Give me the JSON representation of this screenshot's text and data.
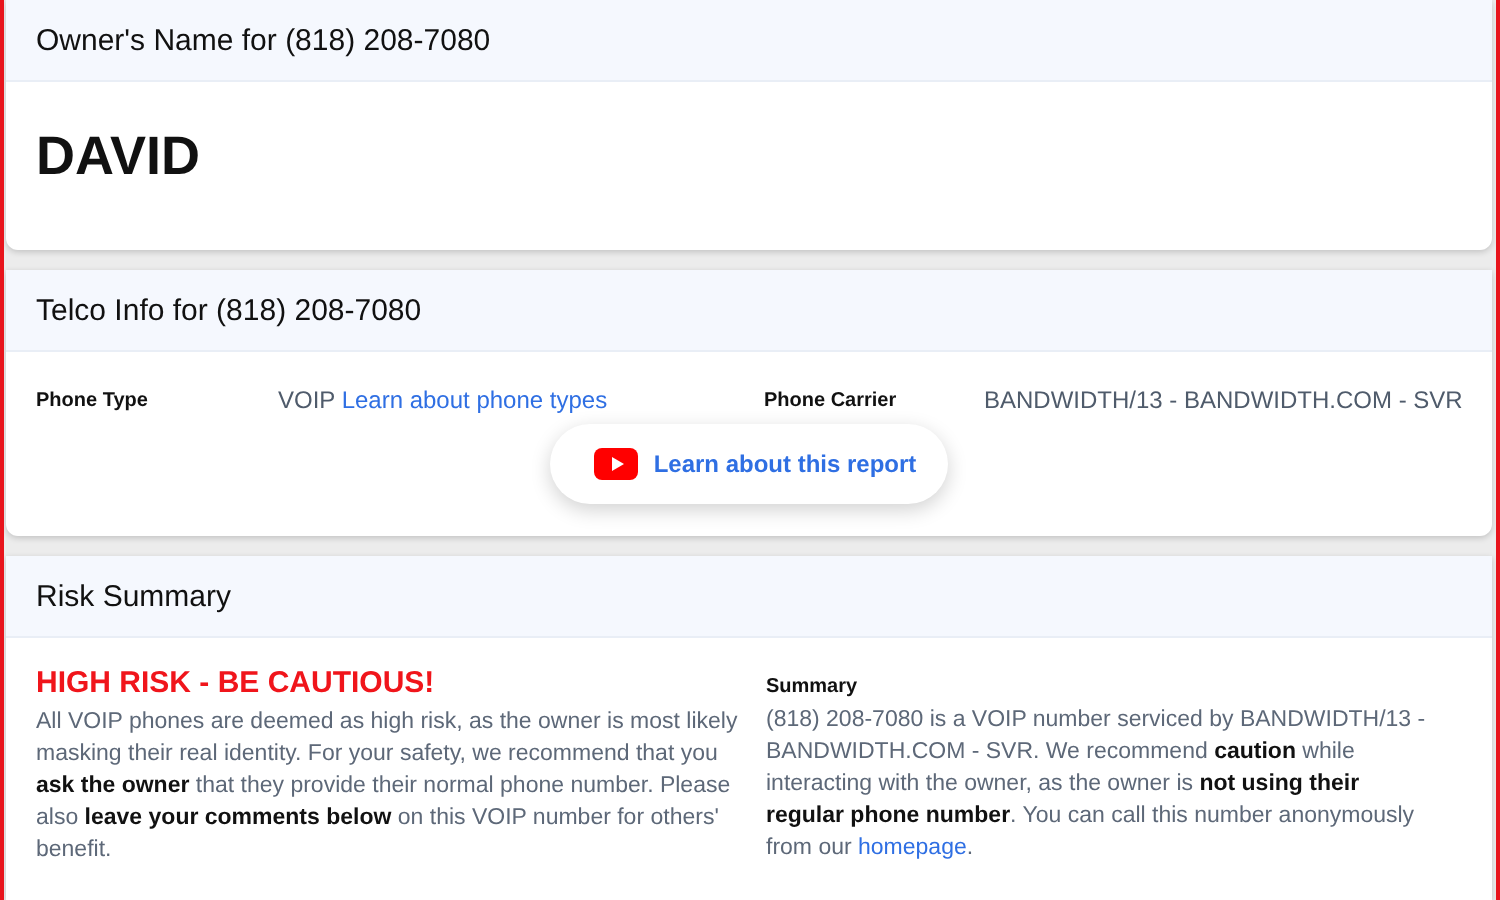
{
  "owner_card": {
    "title": "Owner's Name for (818) 208-7080",
    "name": "DAVID"
  },
  "telco_card": {
    "title": "Telco Info for (818) 208-7080",
    "phone_type_label": "Phone Type",
    "phone_type_value": "VOIP",
    "phone_type_link": "Learn about phone types",
    "carrier_label": "Phone Carrier",
    "carrier_value": "BANDWIDTH/13 - BANDWIDTH.COM - SVR",
    "video_button": "Learn about this report"
  },
  "risk_card": {
    "title": "Risk Summary",
    "headline": "HIGH RISK - BE CAUTIOUS!",
    "description": "All VOIP phones are deemed as high risk, as the owner is most likely masking their real identity. For your safety, we recommend that you **ask the owner** that they provide their normal phone number. Please also **leave your comments below** on this VOIP number for others' benefit.",
    "summary_label": "Summary",
    "summary_text": "(818) 208-7080 is a VOIP number serviced by BANDWIDTH/13 - BANDWIDTH.COM - SVR. We recommend **caution** while interacting with the owner, as the owner is **not using their regular phone number**. You can call this number anonymously from our ",
    "summary_link": "homepage",
    "summary_tail": "."
  }
}
